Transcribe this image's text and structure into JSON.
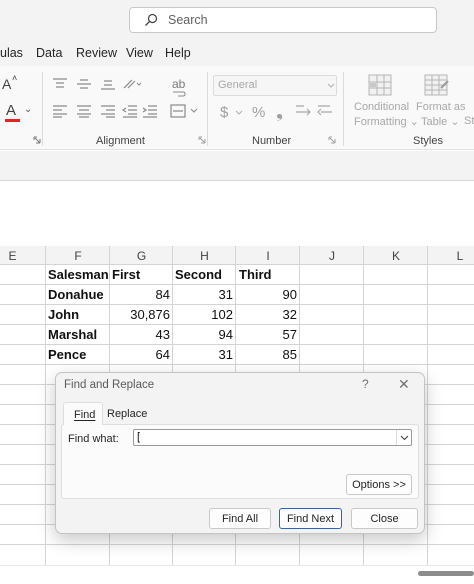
{
  "titlebar": {
    "search_label": "Search"
  },
  "menu": {
    "items": [
      "ulas",
      "Data",
      "Review",
      "View",
      "Help"
    ]
  },
  "ribbon": {
    "font": {
      "font_a_label": "A",
      "font_a_caret": "˄",
      "font_color_label": "A",
      "font_color_caret": "⌄"
    },
    "alignment": {
      "label": "Alignment",
      "wrap_icon_text": "ab"
    },
    "number": {
      "label": "Number",
      "format_value": "General",
      "currency_symbol": "$",
      "percent_symbol": "%",
      "comma_symbol": "❟"
    },
    "styles": {
      "label": "Styles",
      "conditional_line1": "Conditional",
      "conditional_line2": "Formatting",
      "format_table_line1": "Format as",
      "format_table_line2": "Table",
      "cell_styles_initial": "St"
    }
  },
  "sheet": {
    "columns": [
      "E",
      "F",
      "G",
      "H",
      "I",
      "J",
      "K",
      "L"
    ],
    "header_row": [
      "Salesman",
      "First",
      "Second",
      "Third"
    ],
    "rows": [
      [
        "Donahue",
        "84",
        "31",
        "90"
      ],
      [
        "John",
        "30,876",
        "102",
        "32"
      ],
      [
        "Marshal",
        "43",
        "94",
        "57"
      ],
      [
        "Pence",
        "64",
        "31",
        "85"
      ]
    ]
  },
  "dialog": {
    "title": "Find and Replace",
    "help_label": "?",
    "close_label": "✕",
    "tabs": [
      "Find",
      "Replace"
    ],
    "find_what_label": "Find what:",
    "find_value": "[",
    "options_button": "Options >>",
    "find_all_button": "Find All",
    "find_next_button": "Find Next",
    "close_button": "Close"
  },
  "colors": {
    "accent": "#2b63c4",
    "font_color_bar": "#e3261d"
  },
  "icons": [
    "search-icon",
    "dialog-launcher-icon",
    "dropdown-chevron-icon"
  ]
}
